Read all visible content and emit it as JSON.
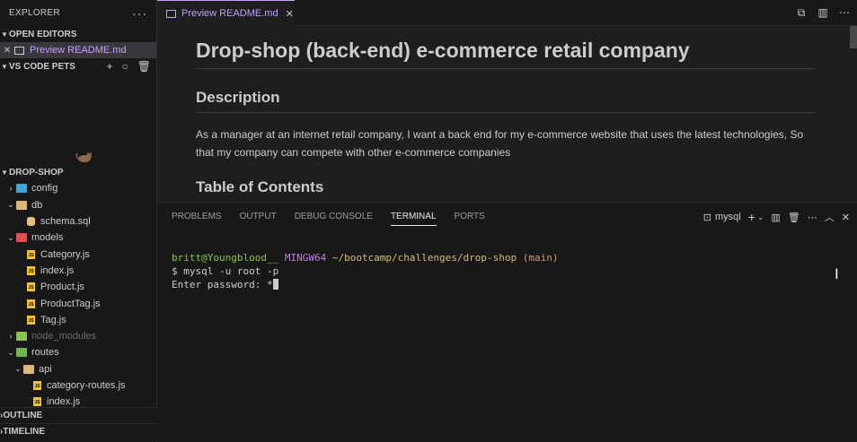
{
  "sidebar": {
    "title": "EXPLORER",
    "more": "···",
    "open_editors": {
      "label": "OPEN EDITORS",
      "items": [
        {
          "name": "Preview README.md"
        }
      ]
    },
    "pets": {
      "label": "VS CODE PETS"
    },
    "project": {
      "label": "DROP-SHOP"
    },
    "tree": {
      "config": "config",
      "db": "db",
      "schema": "schema.sql",
      "models": "models",
      "category": "Category.js",
      "index": "index.js",
      "product": "Product.js",
      "producttag": "ProductTag.js",
      "tag": "Tag.js",
      "node_modules": "node_modules",
      "routes": "routes",
      "api": "api",
      "category_routes": "category-routes.js",
      "api_index": "index.js"
    },
    "outline": "OUTLINE",
    "timeline": "TIMELINE"
  },
  "editor": {
    "tab_label": "Preview README.md",
    "h1": "Drop-shop (back-end) e-commerce retail company",
    "h2_description": "Description",
    "description": "As a manager at an internet retail company, I want a back end for my e-commerce website that uses the latest technologies, So that my company can compete with other e-commerce companies",
    "h2_toc": "Table of Contents"
  },
  "panel": {
    "tabs": [
      "PROBLEMS",
      "OUTPUT",
      "DEBUG CONSOLE",
      "TERMINAL",
      "PORTS"
    ],
    "active_tab": "TERMINAL",
    "terminal_name": "mysql",
    "terminal": {
      "user": "britt@Youngblood__",
      "host": "MINGW64",
      "path": "~/bootcamp/challenges/drop-shop",
      "branch": "(main)",
      "command": "$ mysql -u root -p",
      "prompt": "Enter password: *"
    }
  },
  "colors": {
    "accent": "#c5a0ff",
    "background": "#1e1e1e",
    "sidebar": "#181818"
  }
}
